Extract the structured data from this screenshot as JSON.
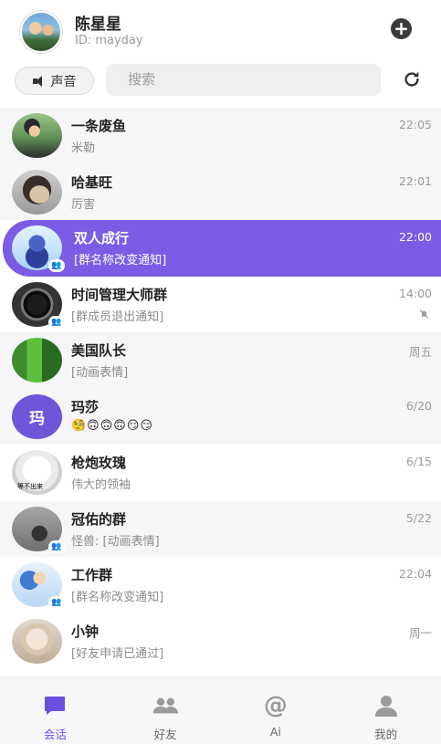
{
  "header": {
    "name": "陈星星",
    "id": "ID: mayday",
    "add_icon": "plus-icon"
  },
  "toolbar": {
    "sound_label": "声音",
    "search_placeholder": "搜索",
    "refresh_icon": "refresh-icon"
  },
  "accent": "#7b5ce5",
  "chats": [
    {
      "name": "一条废鱼",
      "preview": "米勒",
      "time": "22:05"
    },
    {
      "name": "哈基旺",
      "preview": "厉害",
      "time": "22:01"
    },
    {
      "name": "双人成行",
      "preview": "[群名称改变通知]",
      "time": "22:00",
      "active": true,
      "group": true
    },
    {
      "name": "时间管理大师群",
      "preview": "[群成员退出通知]",
      "time": "14:00",
      "group": true,
      "muted": true
    },
    {
      "name": "美国队长",
      "preview": "[动画表情]",
      "time": "周五"
    },
    {
      "name": "玛莎",
      "preview": "🧐🙃🙃🙃😏😏",
      "time": "6/20",
      "avatar_letter": "玛"
    },
    {
      "name": "枪炮玫瑰",
      "preview": "伟大的领袖",
      "time": "6/15",
      "avatar_caption": "等不出来"
    },
    {
      "name": "冠佑的群",
      "preview": "怪兽: [动画表情]",
      "time": "5/22",
      "group": true
    },
    {
      "name": "工作群",
      "preview": "[群名称改变通知]",
      "time": "22:04",
      "group": true
    },
    {
      "name": "小钟",
      "preview": "[好友申请已通过]",
      "time": "周一"
    }
  ],
  "nav": [
    {
      "label": "会话",
      "icon": "chat-bubble-icon",
      "active": true
    },
    {
      "label": "好友",
      "icon": "friends-icon"
    },
    {
      "label": "Ai",
      "icon": "at-sign-icon"
    },
    {
      "label": "我的",
      "icon": "user-icon"
    }
  ]
}
